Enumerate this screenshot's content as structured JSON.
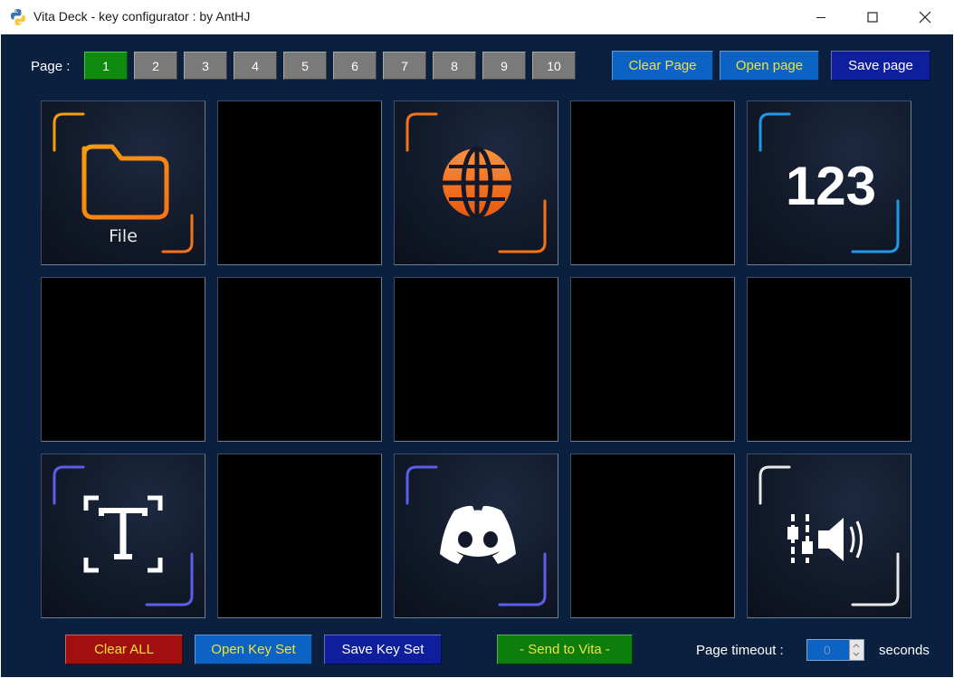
{
  "window": {
    "title": "Vita Deck - key configurator : by AntHJ"
  },
  "page_selector": {
    "label": "Page :",
    "pages": [
      "1",
      "2",
      "3",
      "4",
      "5",
      "6",
      "7",
      "8",
      "9",
      "10"
    ],
    "active": "1"
  },
  "toolbar": {
    "clear_page": "Clear Page",
    "open_page": "Open page",
    "save_page": "Save page"
  },
  "keys": [
    {
      "icon": "folder-icon",
      "label": "File",
      "accent": "#f59e0b"
    },
    {
      "icon": "",
      "label": ""
    },
    {
      "icon": "globe-icon",
      "label": "",
      "accent": "#f97316"
    },
    {
      "icon": "",
      "label": ""
    },
    {
      "icon": "numbers-123-icon",
      "label": "",
      "accent": "#1e9be8"
    },
    {
      "icon": "",
      "label": ""
    },
    {
      "icon": "",
      "label": ""
    },
    {
      "icon": "",
      "label": ""
    },
    {
      "icon": "",
      "label": ""
    },
    {
      "icon": "",
      "label": ""
    },
    {
      "icon": "text-select-icon",
      "label": "",
      "accent": "#5b5fe8"
    },
    {
      "icon": "",
      "label": ""
    },
    {
      "icon": "discord-icon",
      "label": "",
      "accent": "#5b5fe8"
    },
    {
      "icon": "",
      "label": ""
    },
    {
      "icon": "volume-mixer-icon",
      "label": "",
      "accent": "#e8e8e8"
    }
  ],
  "footer": {
    "clear_all": "Clear ALL",
    "open_key_set": "Open Key Set",
    "save_key_set": "Save Key Set",
    "send_to_vita": "- Send to Vita -",
    "timeout_label": "Page timeout :",
    "timeout_value": "0",
    "seconds_label": "seconds"
  }
}
